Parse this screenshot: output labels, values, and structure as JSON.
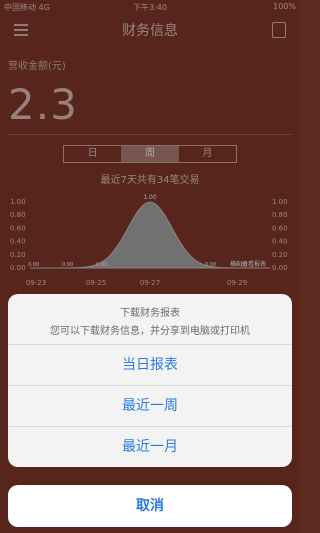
{
  "status_bar": {
    "carrier": "中国移动 4G",
    "time": "下午3:40",
    "battery": "100%"
  },
  "nav": {
    "title": "财务信息",
    "menu_icon": "menu-icon",
    "doc_icon": "document-icon"
  },
  "revenue": {
    "label": "营收金额(元)",
    "value": "2.3"
  },
  "period_tabs": [
    {
      "label": "日",
      "selected": false
    },
    {
      "label": "周",
      "selected": true
    },
    {
      "label": "月",
      "selected": false
    }
  ],
  "summary": "最近7天共有34笔交易",
  "chart_data": {
    "type": "area",
    "x": [
      "09-23",
      "09-25",
      "09-27",
      "09-29"
    ],
    "values": [
      0.0,
      0.0,
      0.0,
      1.0,
      0.0,
      0.0
    ],
    "y_ticks": [
      "1.00",
      "0.80",
      "0.60",
      "0.40",
      "0.20",
      "0.00"
    ],
    "peak_label": "1.00",
    "point_labels": [
      "0.00",
      "0.00",
      "0.00",
      "0.00",
      "0.00"
    ],
    "legend_hint": "横向查看报表",
    "colors": {
      "area": "#a9a9a9",
      "bg": "#7c2f22"
    }
  },
  "action_sheet": {
    "title": "下载财务报表",
    "message": "您可以下载财务信息，并分享到电脑或打印机",
    "options": [
      "当日报表",
      "最近一周",
      "最近一月"
    ],
    "cancel": "取消"
  }
}
